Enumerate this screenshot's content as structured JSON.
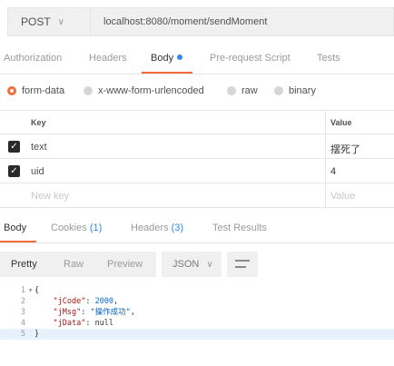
{
  "request": {
    "method": "POST",
    "url": "localhost:8080/moment/sendMoment"
  },
  "request_tabs": {
    "authorization": "Authorization",
    "headers": "Headers",
    "body": "Body",
    "prerequest": "Pre-request Script",
    "tests": "Tests"
  },
  "body_types": {
    "form_data": "form-data",
    "urlencoded": "x-www-form-urlencoded",
    "raw": "raw",
    "binary": "binary",
    "selected": "form-data"
  },
  "kv_table": {
    "key_header": "Key",
    "value_header": "Value",
    "rows": [
      {
        "key": "text",
        "value": "摆死了",
        "checked": true
      },
      {
        "key": "uid",
        "value": "4",
        "checked": true
      }
    ],
    "new_key_placeholder": "New key",
    "value_placeholder": "Value"
  },
  "response_tabs": {
    "body": "Body",
    "cookies": "Cookies",
    "cookies_count": "(1)",
    "headers": "Headers",
    "headers_count": "(3)",
    "test_results": "Test Results"
  },
  "response_toolbar": {
    "pretty": "Pretty",
    "raw": "Raw",
    "preview": "Preview",
    "format": "JSON"
  },
  "code": {
    "line_numbers": [
      "1",
      "2",
      "3",
      "4",
      "5"
    ],
    "open_brace": "{",
    "close_brace": "}",
    "code_key": "\"jCode\"",
    "code_value": "2000",
    "msg_key": "\"jMsg\"",
    "msg_value": "\"操作成功\"",
    "data_key": "\"jData\"",
    "data_value": "null"
  },
  "colors": {
    "accent": "#f26b3a",
    "link_blue": "#2f8af0"
  }
}
